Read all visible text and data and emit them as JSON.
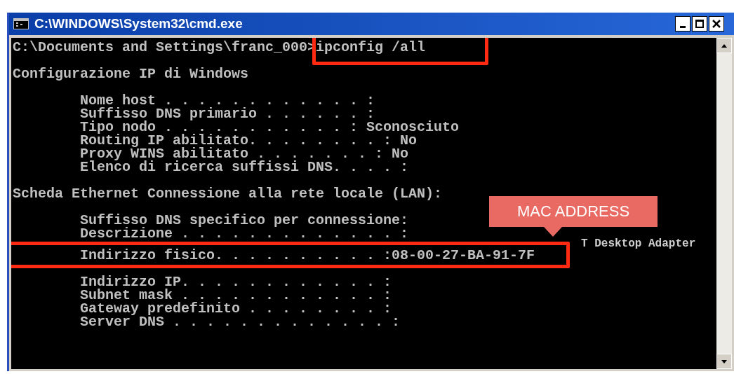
{
  "window": {
    "title": "C:\\WINDOWS\\System32\\cmd.exe"
  },
  "console": {
    "lines": [
      {
        "kind": "command",
        "prompt": "C:\\Documents and Settings\\franc_000>",
        "command": "ipconfig /all"
      },
      {
        "kind": "blank"
      },
      {
        "kind": "text",
        "text": "Configurazione IP di Windows"
      },
      {
        "kind": "blank"
      },
      {
        "kind": "text",
        "text": "        Nome host . . . . . . . . . . . . :"
      },
      {
        "kind": "text",
        "text": "        Suffisso DNS primario . . . . . . :"
      },
      {
        "kind": "text",
        "text": "        Tipo nodo . . . . . . . . . . . : Sconosciuto"
      },
      {
        "kind": "text",
        "text": "        Routing IP abilitato. . . . . . . . : No"
      },
      {
        "kind": "text",
        "text": "        Proxy WINS abilitato . . . . . . . : No"
      },
      {
        "kind": "text",
        "text": "        Elenco di ricerca suffissi DNS. . . . :"
      },
      {
        "kind": "blank"
      },
      {
        "kind": "text",
        "text": "Scheda Ethernet Connessione alla rete locale (LAN):"
      },
      {
        "kind": "blank"
      },
      {
        "kind": "text",
        "text": "        Suffisso DNS specifico per connessione:"
      },
      {
        "kind": "text",
        "text": "        Descrizione . . . . . . . . . . . . . :"
      },
      {
        "kind": "partial",
        "text": "T Desktop Adapter"
      },
      {
        "kind": "highlight",
        "text": "        Indirizzo fisico. . . . . . . . . . :08-00-27-BA-91-7F"
      },
      {
        "kind": "blank"
      },
      {
        "kind": "text",
        "text": "        Indirizzo IP. . . . . . . . . . . . :"
      },
      {
        "kind": "text",
        "text": "        Subnet mask . . . . . . . . . . . . :"
      },
      {
        "kind": "text",
        "text": "        Gateway predefinito . . . . . . . . :"
      },
      {
        "kind": "text",
        "text": "        Server DNS . . . . . . . . . . . . . :"
      }
    ]
  },
  "callout": {
    "text": "MAC ADDRESS"
  }
}
